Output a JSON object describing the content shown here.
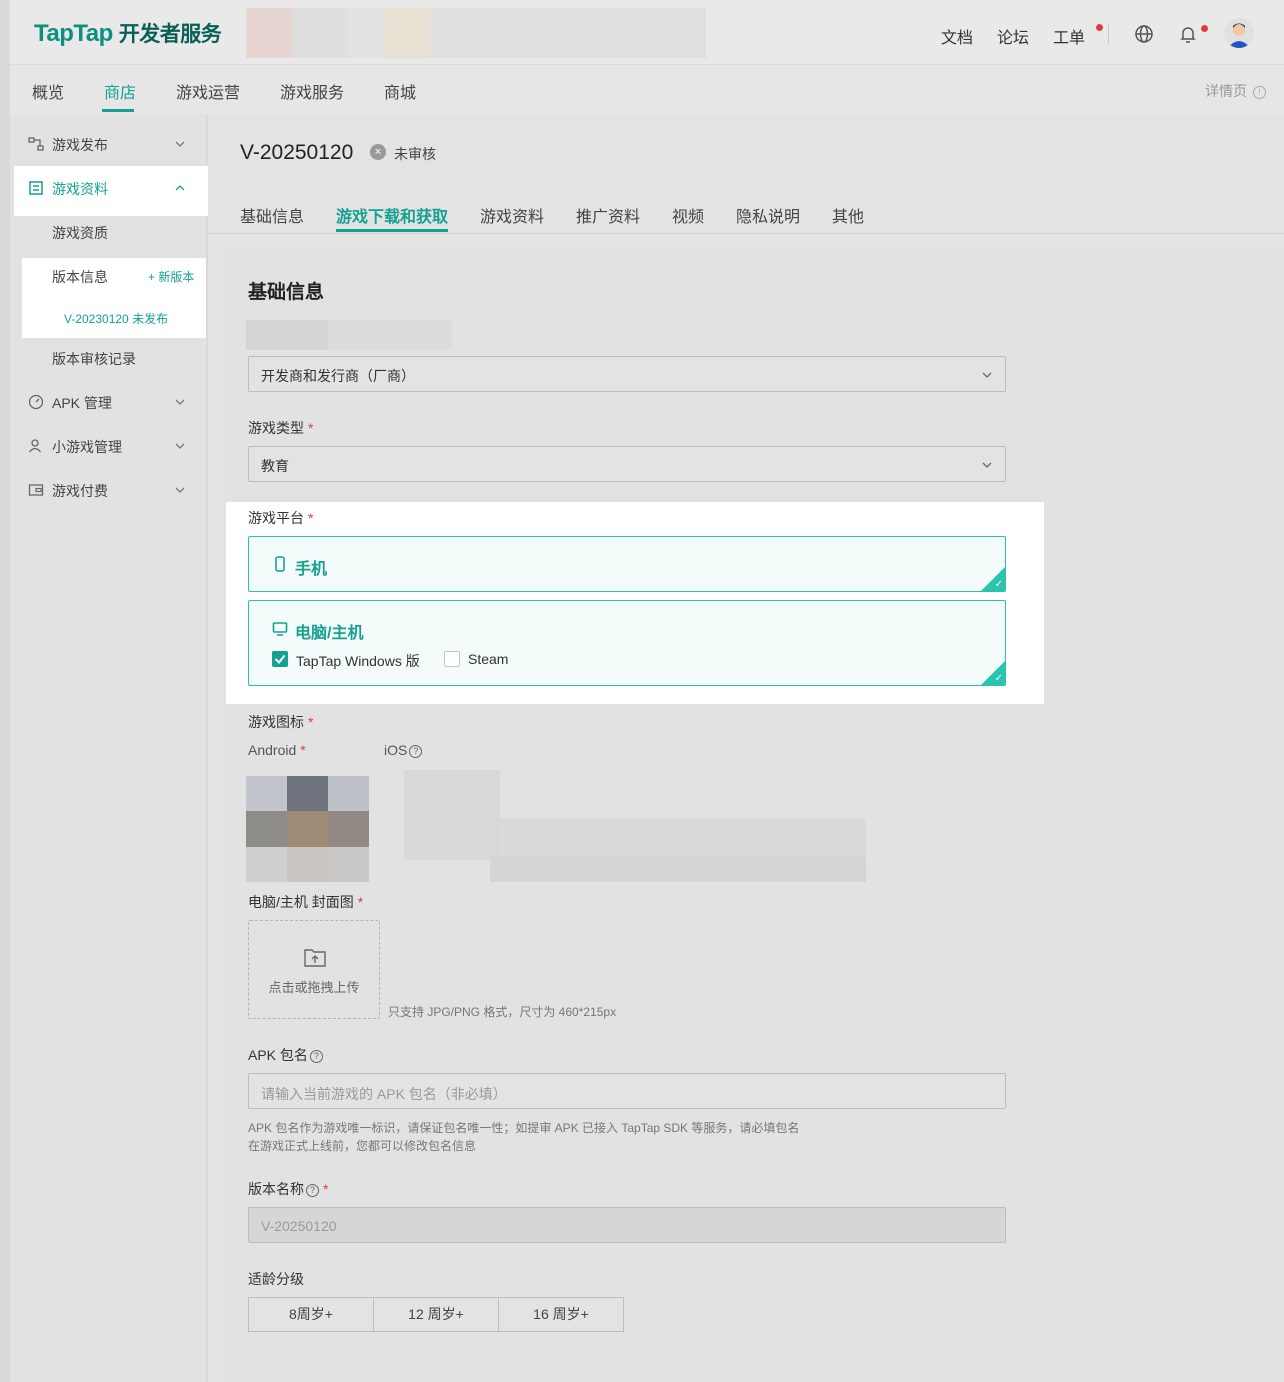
{
  "brand": {
    "logo_en": "TapTap",
    "logo_cn": "开发者服务"
  },
  "topnav": {
    "docs": "文档",
    "forum": "论坛",
    "ticket": "工单"
  },
  "subnav": {
    "tabs": [
      "概览",
      "商店",
      "游戏运营",
      "游戏服务",
      "商城"
    ],
    "active": "商店",
    "detail": "详情页"
  },
  "sidebar": {
    "items": [
      {
        "label": "游戏发布",
        "icon": "flow-icon"
      },
      {
        "label": "游戏资料",
        "icon": "store-icon",
        "active": true
      },
      {
        "label": "APK 管理",
        "icon": "gauge-icon"
      },
      {
        "label": "小游戏管理",
        "icon": "user-icon"
      },
      {
        "label": "游戏付费",
        "icon": "wallet-icon"
      }
    ],
    "sub_items": {
      "qualification": "游戏资质",
      "version_info": "版本信息",
      "new_version": "+ 新版本",
      "version_link": "V-20230120 未发布",
      "review_log": "版本审核记录"
    }
  },
  "page": {
    "version_title": "V-20250120",
    "status": "未审核",
    "tabs": [
      "基础信息",
      "游戏下载和获取",
      "游戏资料",
      "推广资料",
      "视频",
      "隐私说明",
      "其他"
    ],
    "active_tab": "游戏下载和获取",
    "section_title": "基础信息"
  },
  "form": {
    "developer_select": "开发商和发行商（厂商）",
    "game_type_label": "游戏类型",
    "game_type_value": "教育",
    "platform_label": "游戏平台",
    "platform_mobile": "手机",
    "platform_pc": "电脑/主机",
    "pc_options": [
      {
        "label": "TapTap Windows 版",
        "checked": true
      },
      {
        "label": "Steam",
        "checked": false
      }
    ],
    "icon_label": "游戏图标",
    "android_label": "Android",
    "ios_label": "iOS",
    "cover_label": "电脑/主机 封面图",
    "upload_text": "点击或拖拽上传",
    "cover_hint": "只支持 JPG/PNG 格式，尺寸为 460*215px",
    "apk_label": "APK 包名",
    "apk_placeholder": "请输入当前游戏的 APK 包名（非必填）",
    "apk_hint_1": "APK 包名作为游戏唯一标识，请保证包名唯一性；如提审 APK 已接入 TapTap SDK 等服务，请必填包名",
    "apk_hint_2": "在游戏正式上线前，您都可以修改包名信息",
    "version_name_label": "版本名称",
    "version_name_value": "V-20250120",
    "age_label": "适龄分级",
    "age_options": [
      "8周岁+",
      "12 周岁+",
      "16 周岁+"
    ]
  },
  "colors": {
    "accent": "#15a191",
    "danger": "#e23a3a"
  }
}
